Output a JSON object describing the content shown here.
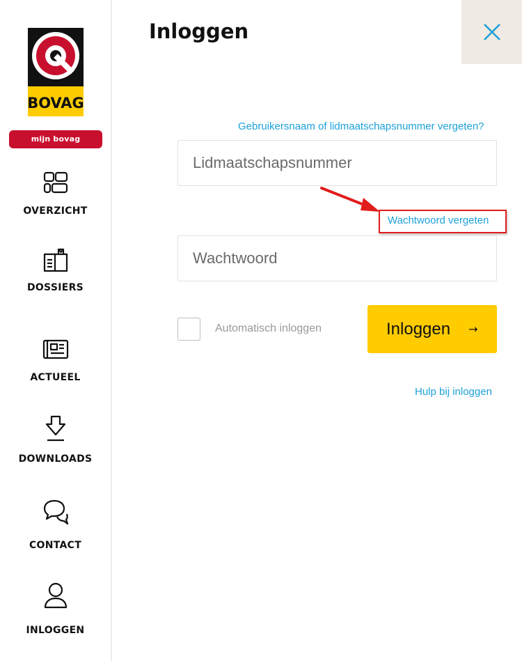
{
  "sidebar": {
    "logo_text": "BOVAG",
    "badge": "MIJN BOVAG",
    "items": [
      {
        "label": "OVERZICHT",
        "icon": "grid-icon"
      },
      {
        "label": "DOSSIERS",
        "icon": "book-icon"
      },
      {
        "label": "ACTUEEL",
        "icon": "newspaper-icon"
      },
      {
        "label": "DOWNLOADS",
        "icon": "download-icon"
      },
      {
        "label": "CONTACT",
        "icon": "chat-icon"
      },
      {
        "label": "INLOGGEN",
        "icon": "user-icon"
      }
    ]
  },
  "main": {
    "title": "Inloggen",
    "close_icon": "close-icon",
    "forgot_username_link": "Gebruikersnaam of lidmaatschapsnummer vergeten?",
    "member_placeholder": "Lidmaatschapsnummer",
    "forgot_password_link": "Wachtwoord vergeten",
    "password_placeholder": "Wachtwoord",
    "auto_login_label": "Automatisch inloggen",
    "login_button": "Inloggen",
    "login_arrow": "→",
    "help_link": "Hulp bij inloggen"
  },
  "colors": {
    "brand_red": "#c8102e",
    "brand_yellow": "#ffcc00",
    "link_blue": "#1da1d8",
    "annotation_red": "#e01c1c"
  }
}
